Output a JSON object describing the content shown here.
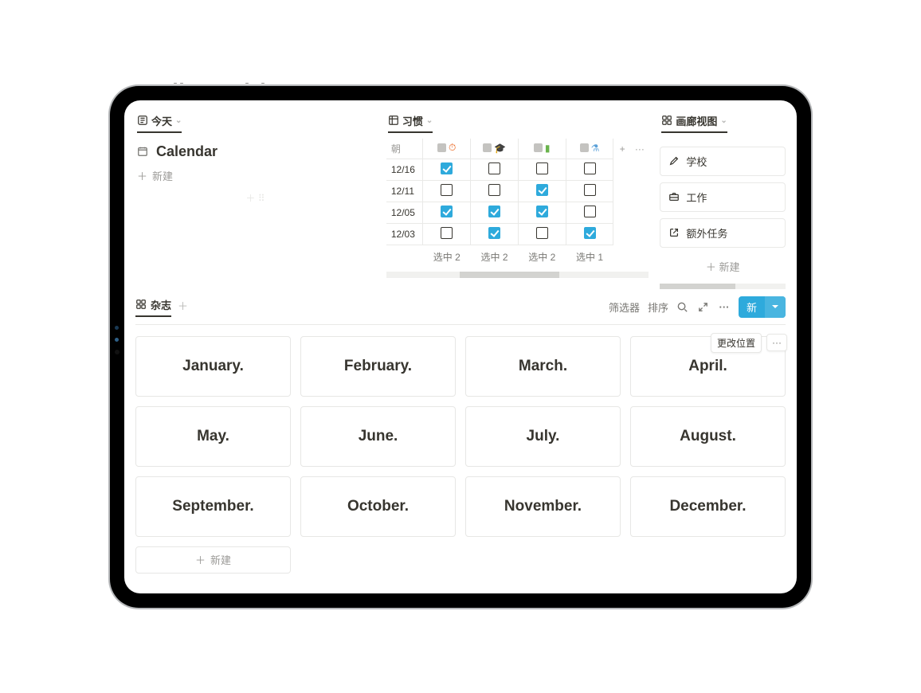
{
  "today": {
    "tab_label": "今天",
    "calendar_title": "Calendar",
    "new_label": "新建"
  },
  "habits": {
    "tab_label": "习惯",
    "date_header": "朝",
    "col_icons": [
      "alarm",
      "grad",
      "book",
      "sparkle"
    ],
    "add_col": "+",
    "more": "···",
    "rows": [
      {
        "date": "12/16",
        "cells": [
          true,
          false,
          false,
          false
        ]
      },
      {
        "date": "12/11",
        "cells": [
          false,
          false,
          true,
          false
        ]
      },
      {
        "date": "12/05",
        "cells": [
          true,
          true,
          true,
          false
        ]
      },
      {
        "date": "12/03",
        "cells": [
          false,
          true,
          false,
          true
        ]
      }
    ],
    "sum_prefix": "选中",
    "sums": [
      "2",
      "2",
      "2",
      "1"
    ]
  },
  "gallery": {
    "tab_label": "画廊视图",
    "items": [
      {
        "icon": "edit",
        "label": "学校"
      },
      {
        "icon": "briefcase",
        "label": "工作"
      },
      {
        "icon": "external",
        "label": "额外任务"
      }
    ],
    "new_label": "新建"
  },
  "journal": {
    "tab_label": "杂志",
    "toolbar": {
      "filter": "筛选器",
      "sort": "排序",
      "new": "新"
    },
    "popover": "更改位置",
    "months": [
      "January.",
      "February.",
      "March.",
      "April.",
      "May.",
      "June.",
      "July.",
      "August.",
      "September.",
      "October.",
      "November.",
      "December."
    ],
    "new_card": "新建"
  }
}
